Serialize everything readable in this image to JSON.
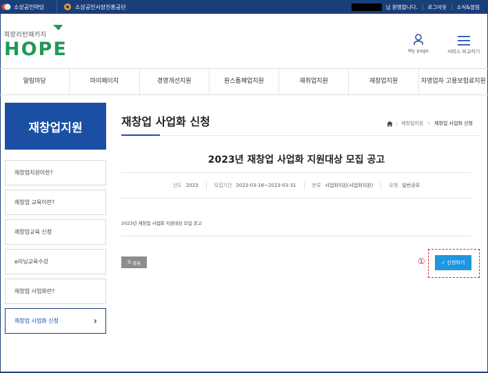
{
  "topbar": {
    "item1": "소상공인마당",
    "item2": "소상공인시장진흥공단",
    "welcome": "님 환영합니다.",
    "logout": "로그아웃",
    "news": "소식&알림"
  },
  "header": {
    "brand_sub": "희망리턴패키지",
    "brand_main": "HOPE",
    "mypage": "My page",
    "service_compare": "서비스 비교하기"
  },
  "nav": [
    "알림마당",
    "마이페이지",
    "경영개선지원",
    "원스톱폐업지원",
    "재취업지원",
    "재창업지원",
    "자영업자 고용보험료지원"
  ],
  "sidebar": {
    "title": "재창업지원",
    "items": [
      {
        "label": "재창업지원이란?"
      },
      {
        "label": "재창업 교육이란?"
      },
      {
        "label": "재창업교육 신청"
      },
      {
        "label": "e러닝교육수강"
      },
      {
        "label": "재창업 사업화란?"
      },
      {
        "label": "재창업 사업화 신청"
      }
    ]
  },
  "main": {
    "title": "재창업 사업화 신청",
    "breadcrumb": [
      "재창업지원",
      "재창업 사업화 신청"
    ],
    "post_title": "2023년 재창업 사업화 지원대상 모집 공고",
    "meta": {
      "year_label": "년도",
      "year": "2023",
      "period_label": "모집기간",
      "period": "2023-03-16~2023-03-31",
      "category_label": "분류",
      "category": "사업화지원(사업화지원)",
      "type_label": "유형",
      "type": "일반공모"
    },
    "content": "2023년 재창업 사업화 지원대상 모집 공고",
    "list_button": "목록",
    "apply_button": "신청하기",
    "annotation": "①"
  }
}
